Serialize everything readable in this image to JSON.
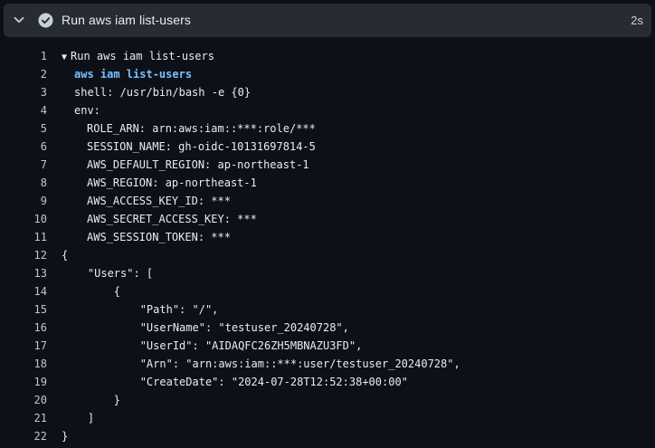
{
  "step": {
    "title": "Run aws iam list-users",
    "duration": "2s",
    "status": "success",
    "status_color": "#c9d1d9"
  },
  "colors": {
    "header_bg": "#272c33",
    "page_bg": "#0d1117",
    "command_text": "#79c0ff"
  },
  "log_lines": [
    {
      "n": "1",
      "text": "Run aws iam list-users",
      "indent": 0,
      "group": true
    },
    {
      "n": "2",
      "text": "aws iam list-users",
      "indent": 1,
      "cmd": true
    },
    {
      "n": "3",
      "text": "shell: /usr/bin/bash -e {0}",
      "indent": 1
    },
    {
      "n": "4",
      "text": "env:",
      "indent": 1
    },
    {
      "n": "5",
      "text": "ROLE_ARN: arn:aws:iam::***:role/***",
      "indent": 2
    },
    {
      "n": "6",
      "text": "SESSION_NAME: gh-oidc-10131697814-5",
      "indent": 2
    },
    {
      "n": "7",
      "text": "AWS_DEFAULT_REGION: ap-northeast-1",
      "indent": 2
    },
    {
      "n": "8",
      "text": "AWS_REGION: ap-northeast-1",
      "indent": 2
    },
    {
      "n": "9",
      "text": "AWS_ACCESS_KEY_ID: ***",
      "indent": 2
    },
    {
      "n": "10",
      "text": "AWS_SECRET_ACCESS_KEY: ***",
      "indent": 2
    },
    {
      "n": "11",
      "text": "AWS_SESSION_TOKEN: ***",
      "indent": 2
    },
    {
      "n": "12",
      "text": "{",
      "indent": 0
    },
    {
      "n": "13",
      "text": "    \"Users\": [",
      "indent": 0
    },
    {
      "n": "14",
      "text": "        {",
      "indent": 0
    },
    {
      "n": "15",
      "text": "            \"Path\": \"/\",",
      "indent": 0
    },
    {
      "n": "16",
      "text": "            \"UserName\": \"testuser_20240728\",",
      "indent": 0
    },
    {
      "n": "17",
      "text": "            \"UserId\": \"AIDAQFC26ZH5MBNAZU3FD\",",
      "indent": 0
    },
    {
      "n": "18",
      "text": "            \"Arn\": \"arn:aws:iam::***:user/testuser_20240728\",",
      "indent": 0
    },
    {
      "n": "19",
      "text": "            \"CreateDate\": \"2024-07-28T12:52:38+00:00\"",
      "indent": 0
    },
    {
      "n": "20",
      "text": "        }",
      "indent": 0
    },
    {
      "n": "21",
      "text": "    ]",
      "indent": 0
    },
    {
      "n": "22",
      "text": "}",
      "indent": 0
    }
  ]
}
